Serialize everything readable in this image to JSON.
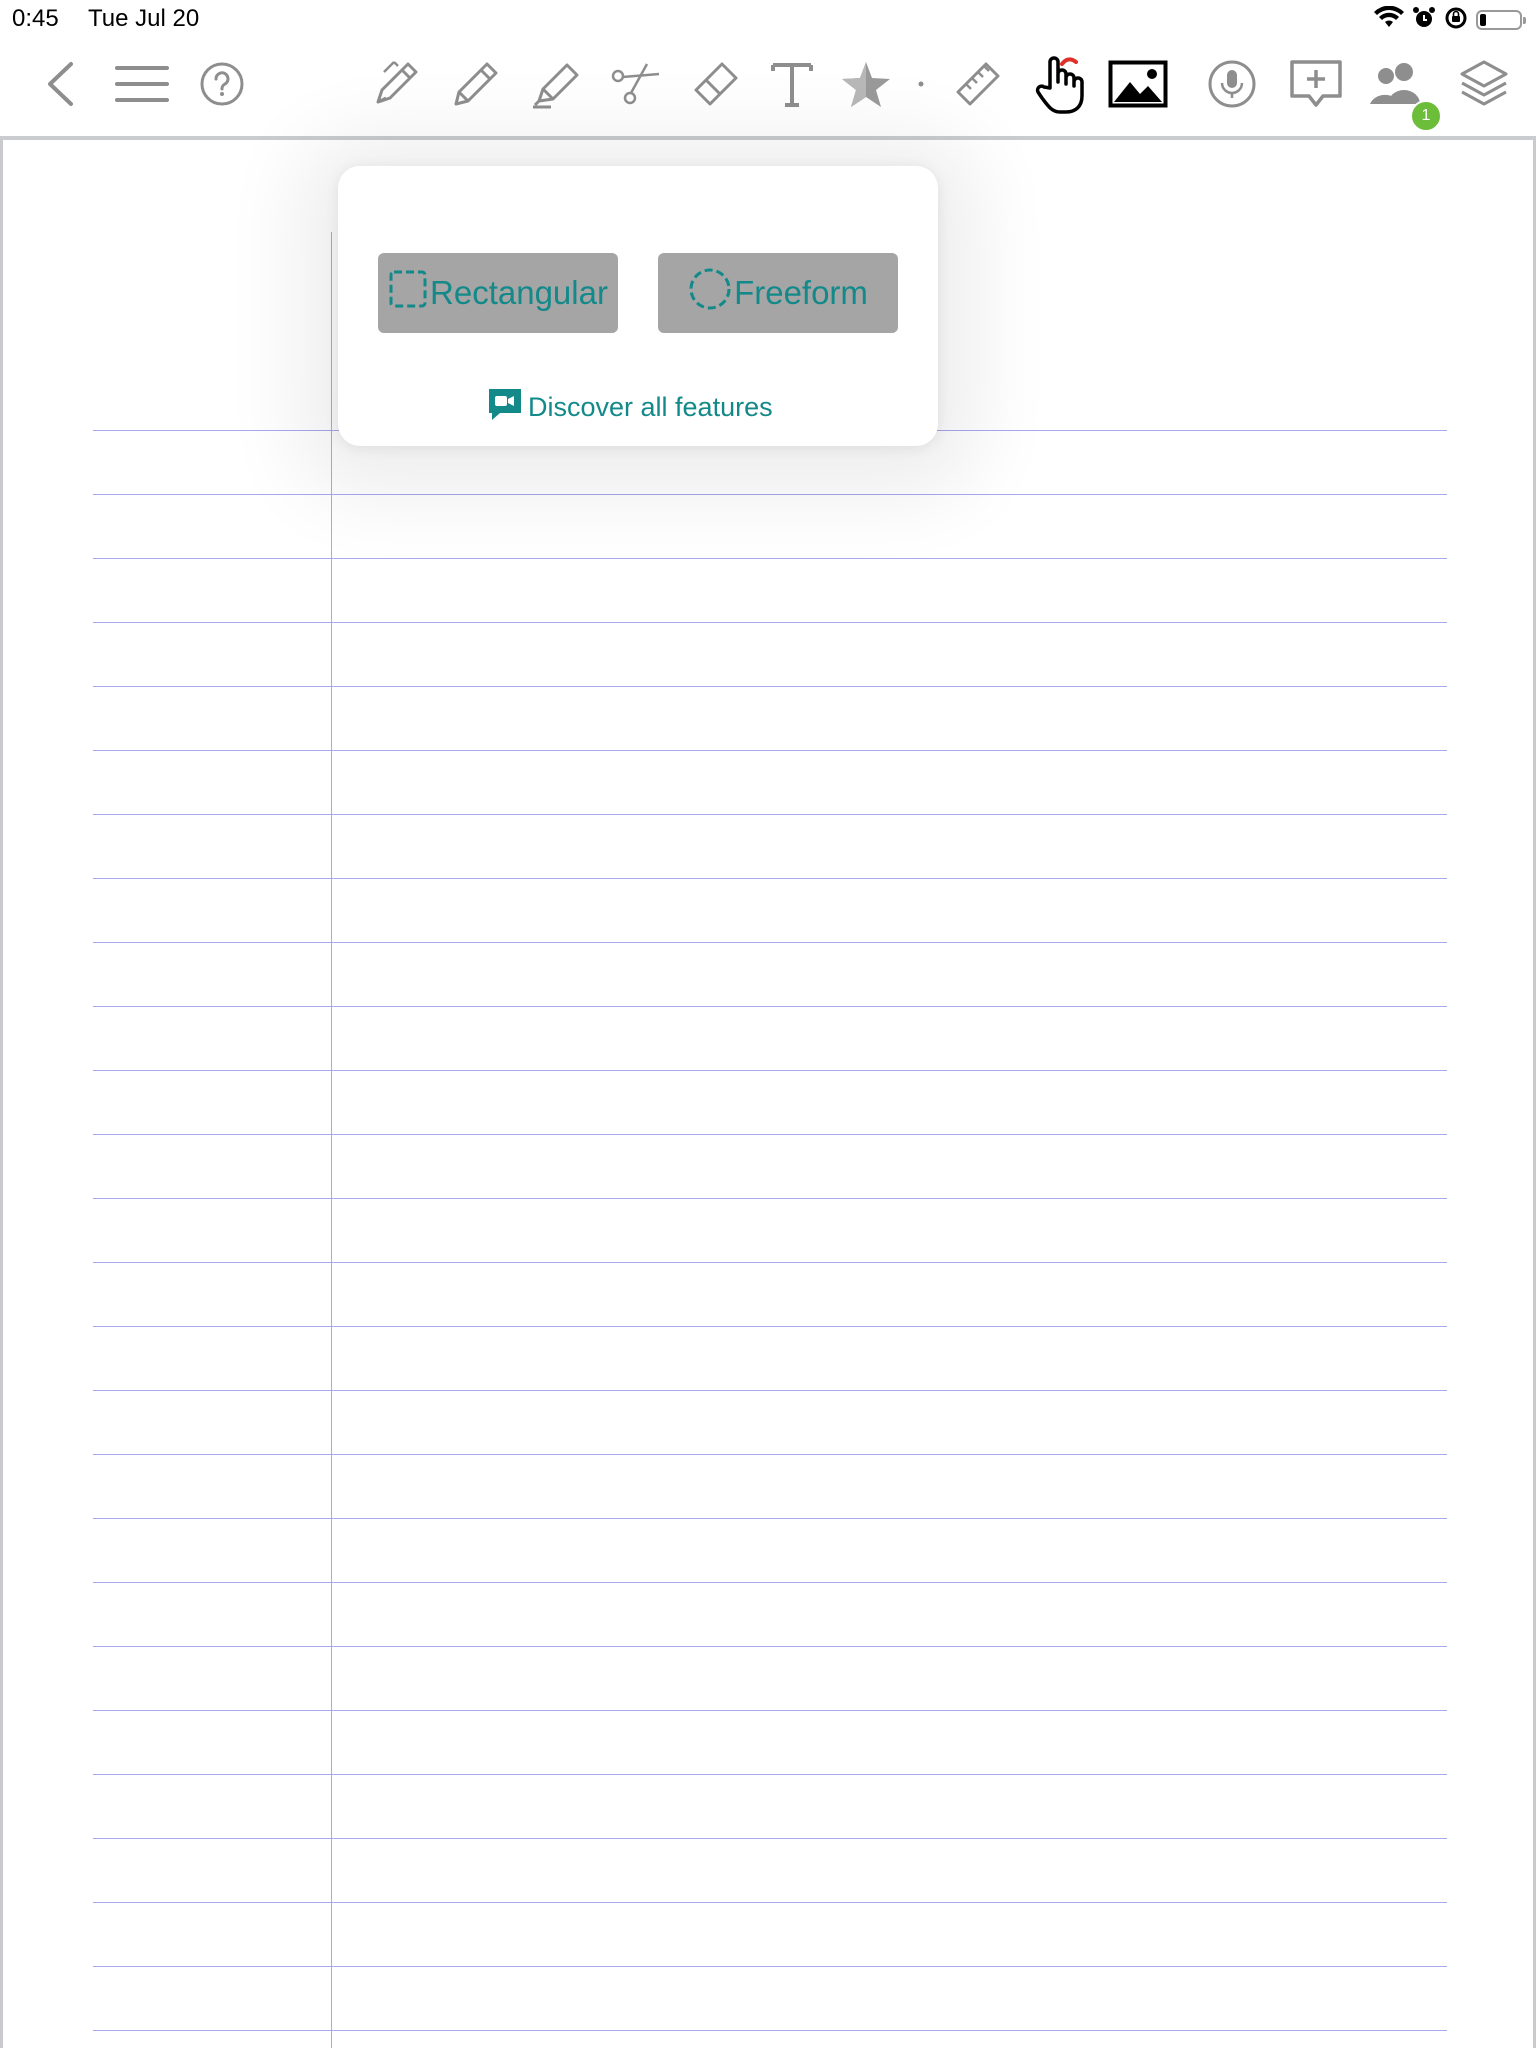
{
  "status": {
    "time": "0:45",
    "date": "Tue Jul 20",
    "icons": [
      "wifi-icon",
      "alarm-icon",
      "orientation-lock-icon",
      "battery-icon"
    ]
  },
  "toolbar": {
    "left": [
      "back-icon",
      "menu-icon",
      "help-icon"
    ],
    "tools": [
      "fountain-pen-icon",
      "pencil-icon",
      "highlighter-icon",
      "scissors-icon",
      "eraser-icon",
      "text-icon",
      "star-shapes-icon",
      "ruler-icon",
      "hand-icon"
    ],
    "right": [
      "image-icon",
      "microphone-icon",
      "add-comment-icon",
      "collaborators-icon",
      "layers-icon"
    ],
    "collaborators_badge": "1",
    "active_tool": "scissors"
  },
  "lasso_popover": {
    "rectangular_label": "Rectangular",
    "freeform_label": "Freeform",
    "discover_label": "Discover all features"
  },
  "colors": {
    "accent": "#13898a",
    "option_bg": "#a5a5a5",
    "rule_line": "#a8a8ee",
    "badge": "#6bbd3a",
    "toolbar_icon": "#8e8e8e"
  }
}
